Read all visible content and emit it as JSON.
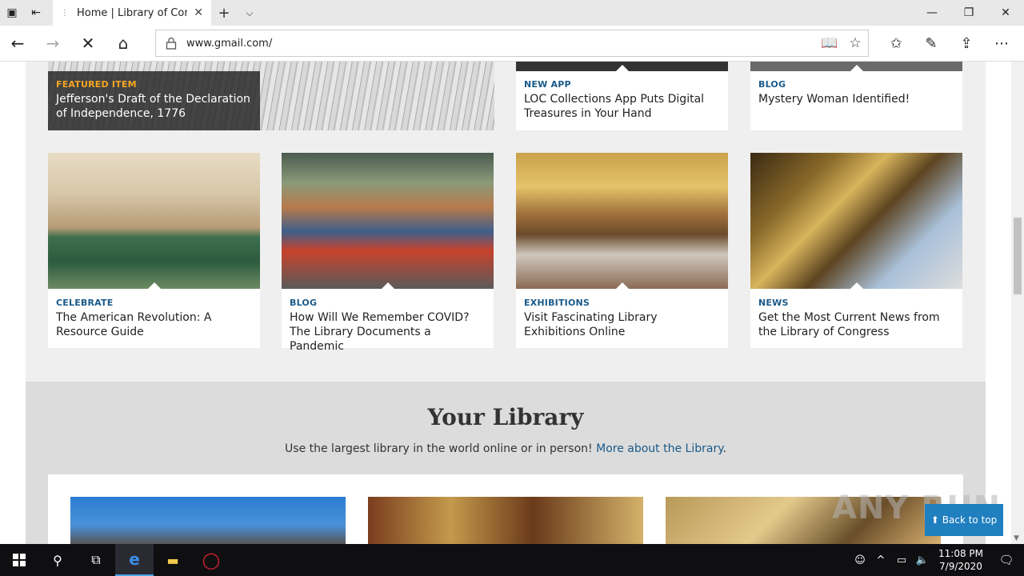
{
  "browser": {
    "tab_title": "Home | Library of Congress",
    "url": "www.gmail.com/",
    "back_to_top": "Back to top"
  },
  "featured": {
    "category": "FEATURED ITEM",
    "title": "Jefferson's Draft of the Declaration of Independence, 1776"
  },
  "top_cards": [
    {
      "category": "NEW APP",
      "title": "LOC Collections App Puts Digital Treasures in Your Hand"
    },
    {
      "category": "BLOG",
      "title": "Mystery Woman Identified!"
    }
  ],
  "cards": [
    {
      "category": "CELEBRATE",
      "title": "The American Revolution: A Resource Guide"
    },
    {
      "category": "BLOG",
      "title": "How Will We Remember COVID? The Library Documents a Pandemic"
    },
    {
      "category": "EXHIBITIONS",
      "title": "Visit Fascinating Library Exhibitions Online"
    },
    {
      "category": "NEWS",
      "title": "Get the Most Current News from the Library of Congress"
    }
  ],
  "your_library": {
    "heading": "Your Library",
    "subtitle": "Use the largest library in the world online or in person!",
    "link": "More about the Library",
    "period": "."
  },
  "watermark": "ANY RUN",
  "taskbar": {
    "time": "11:08 PM",
    "date": "7/9/2020"
  },
  "icons": {
    "tab_actions": "tab-actions-icon",
    "set_aside": "set-aside-icon",
    "back": "back-arrow-icon",
    "forward": "forward-arrow-icon",
    "stop": "stop-icon",
    "home": "home-icon"
  }
}
